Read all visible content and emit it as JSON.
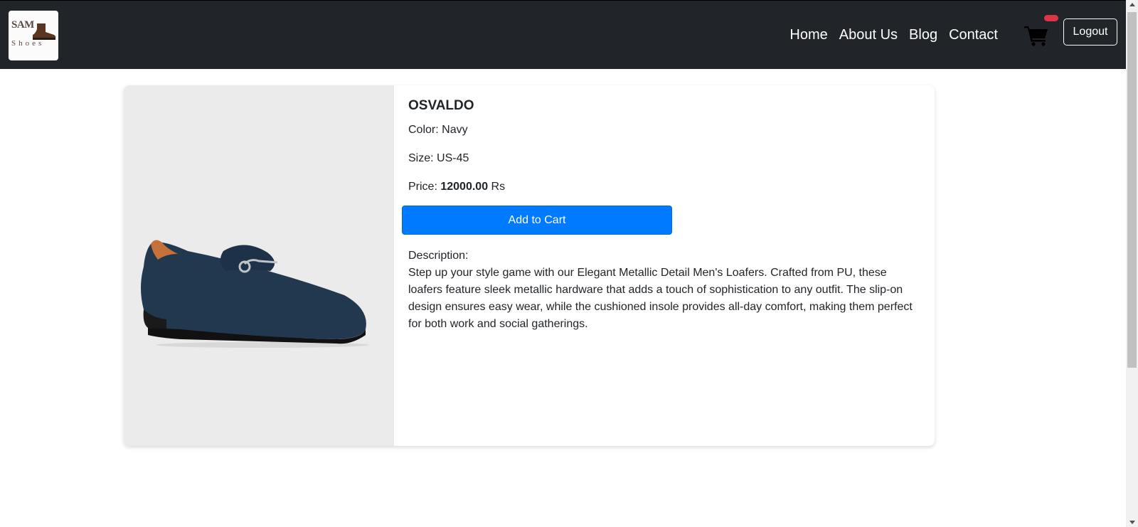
{
  "header": {
    "logo": {
      "top_text": "SAM",
      "bottom_text": "Shoes"
    },
    "nav": [
      "Home",
      "About Us",
      "Blog",
      "Contact"
    ],
    "logout_label": "Logout",
    "badge_color": "#dc3545"
  },
  "product": {
    "name": "OSVALDO",
    "color_label": "Color:",
    "color_value": "Navy",
    "size_label": "Size:",
    "size_value": "US-45",
    "price_label": "Price:",
    "price_value": "12000.00",
    "price_currency": "Rs",
    "add_to_cart_label": "Add to Cart",
    "description_label": "Description:",
    "description": "Step up your style game with our Elegant Metallic Detail Men's Loafers. Crafted from PU, these loafers feature sleek metallic hardware that adds a touch of sophistication to any outfit. The slip-on design ensures easy wear, while the cushioned insole provides all-day comfort, making them perfect for both work and social gatherings."
  },
  "theme": {
    "navbar_bg": "#212529",
    "primary": "#007bff",
    "image_bg": "#ebebeb"
  }
}
